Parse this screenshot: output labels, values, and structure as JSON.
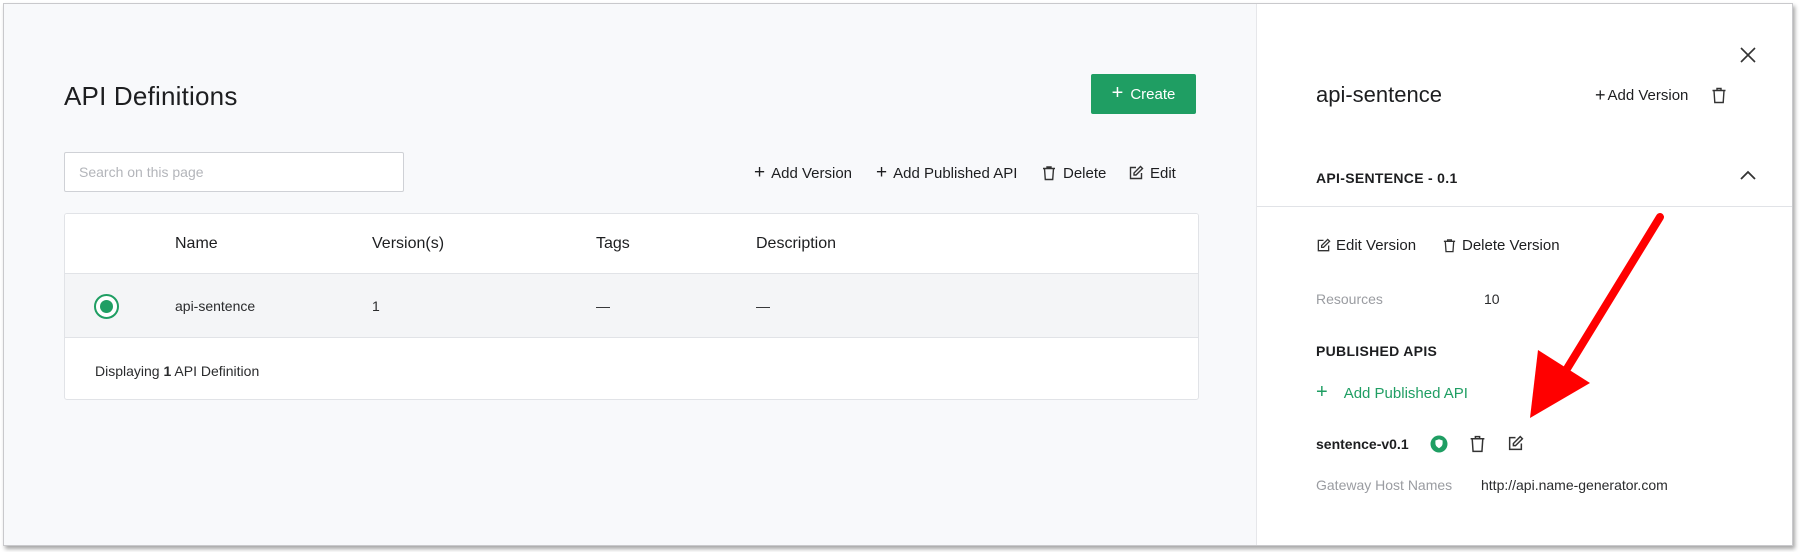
{
  "main": {
    "title": "API Definitions",
    "create_label": "Create",
    "search_placeholder": "Search on this page",
    "toolbar": {
      "add_version": "Add Version",
      "add_published_api": "Add Published API",
      "delete": "Delete",
      "edit": "Edit"
    },
    "table": {
      "columns": [
        "Name",
        "Version(s)",
        "Tags",
        "Description"
      ],
      "rows": [
        {
          "name": "api-sentence",
          "versions": "1",
          "tags": "—",
          "description": "—",
          "selected": true
        }
      ],
      "footer_prefix": "Displaying",
      "footer_count": "1",
      "footer_suffix": "API Definition"
    }
  },
  "panel": {
    "title": "api-sentence",
    "add_version": "Add Version",
    "version_title": "API-SENTENCE - 0.1",
    "edit_version": "Edit Version",
    "delete_version": "Delete Version",
    "resources_label": "Resources",
    "resources_value": "10",
    "published_heading": "PUBLISHED APIS",
    "add_published_api": "Add Published API",
    "published": [
      {
        "name": "sentence-v0.1",
        "icons": [
          "shield-icon",
          "trash-icon",
          "edit-icon"
        ],
        "gateway_label": "Gateway Host Names",
        "gateway_value": "http://api.name-generator.com"
      }
    ]
  },
  "colors": {
    "accent": "#1f9e63",
    "annotation_arrow": "#ff0000"
  }
}
